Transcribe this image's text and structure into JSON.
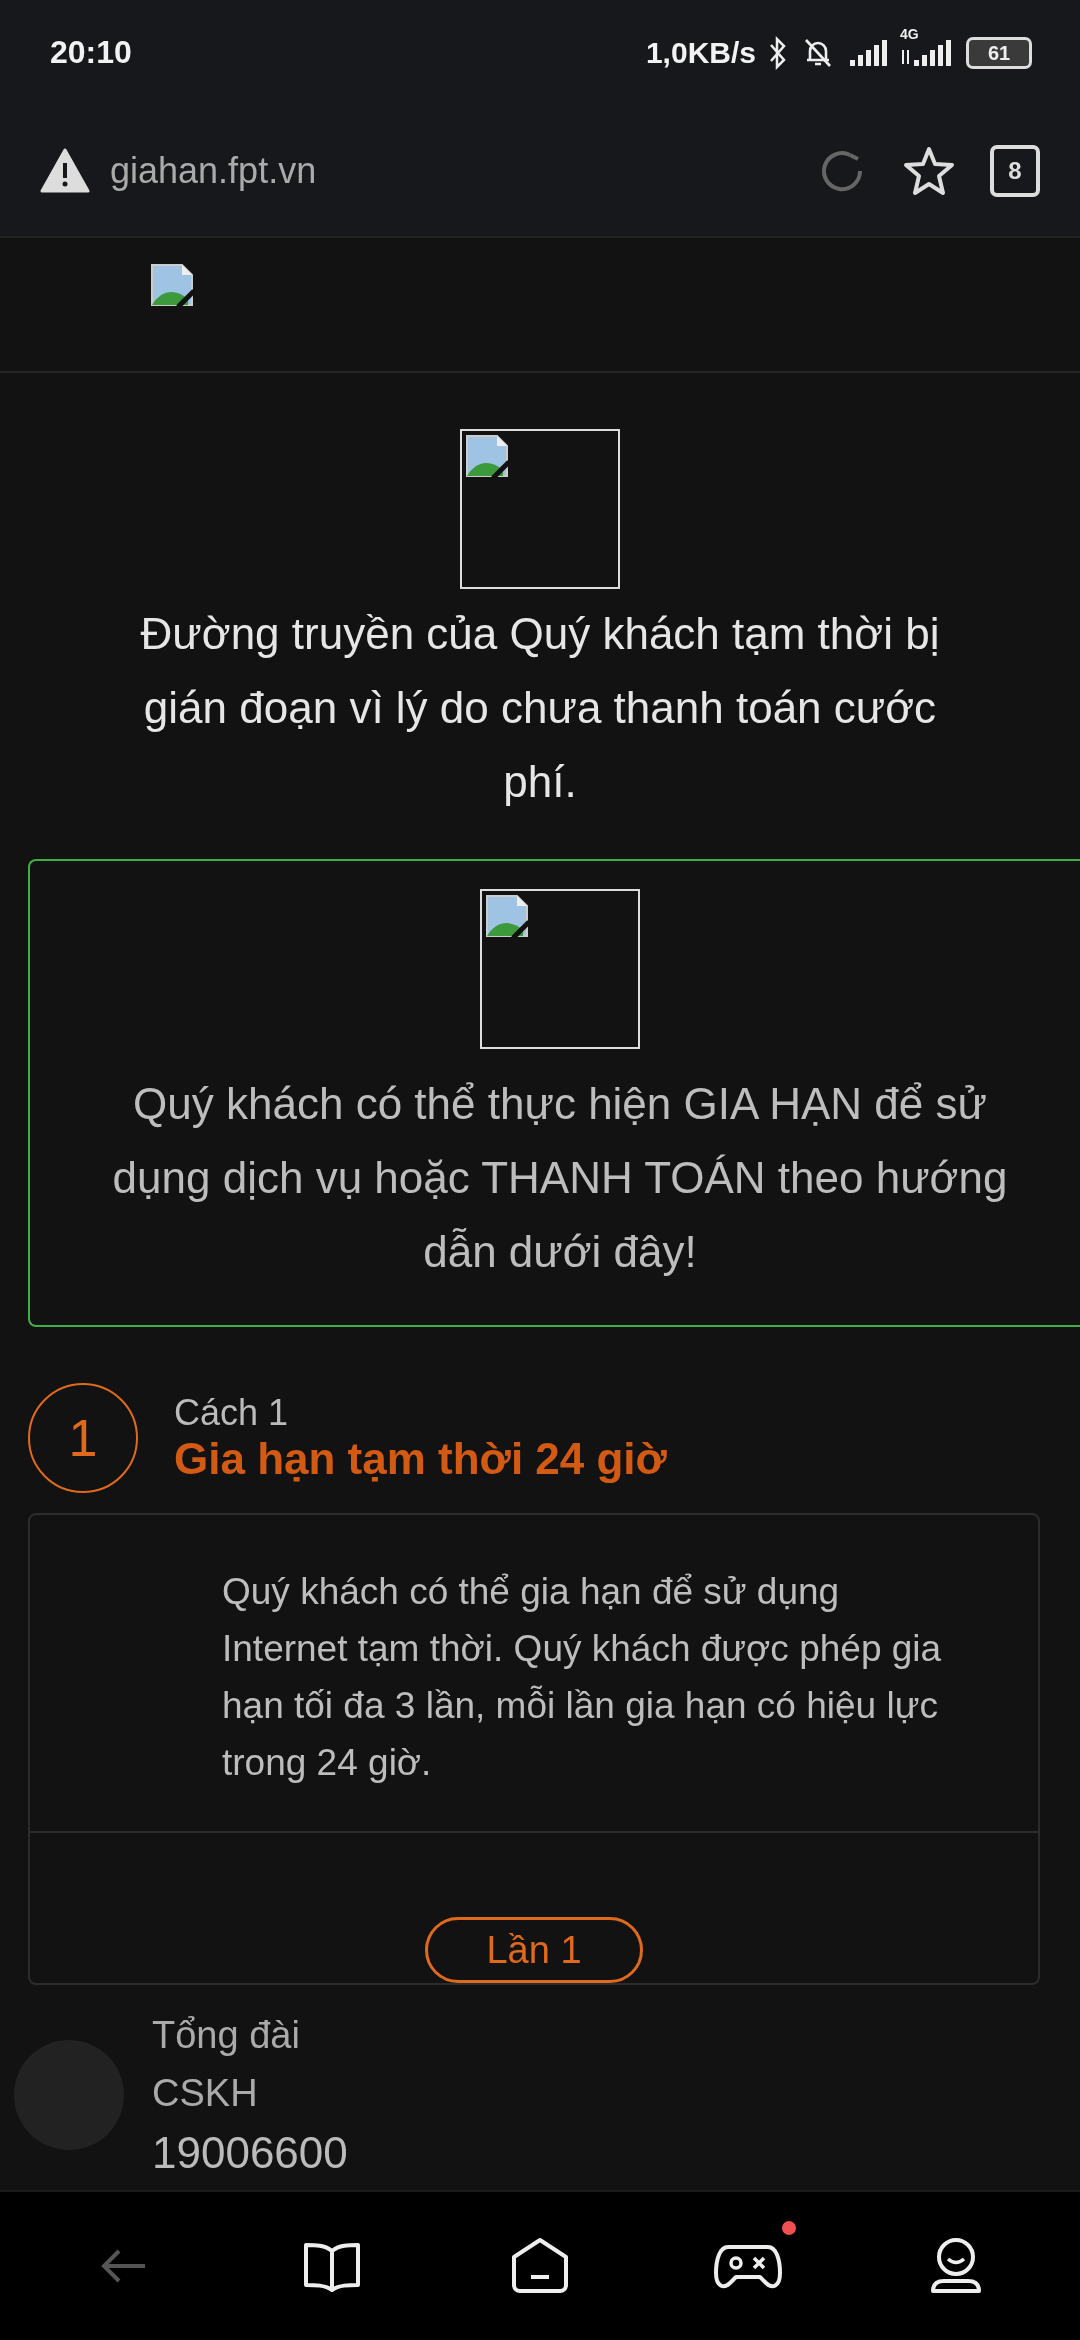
{
  "status_bar": {
    "time": "20:10",
    "network_speed": "1,0KB/s",
    "network_type": "4G",
    "battery": "61"
  },
  "browser": {
    "url": "giahan.fpt.vn",
    "tab_count": "8"
  },
  "notice": {
    "message": "Đường truyền của Quý khách tạm thời bị gián đoạn vì lý do chưa thanh toán cước phí."
  },
  "callout": {
    "message": "Quý khách có thể thực hiện GIA HẠN để sử dụng dịch vụ hoặc THANH TOÁN theo hướng dẫn dưới đây!"
  },
  "steps": [
    {
      "number": "1",
      "label": "Cách 1",
      "title": "Gia hạn tạm thời 24 giờ",
      "description": "Quý khách có thể gia hạn để sử dụng Internet tạm thời. Quý khách được phép gia hạn tối đa 3 lần, mỗi lần gia hạn có hiệu lực trong 24 giờ.",
      "buttons": [
        "Lần 1"
      ]
    }
  ],
  "contact": {
    "label_line_1": "Tổng đài",
    "label_line_2": "CSKH",
    "phone": "19006600"
  },
  "nav": {
    "items": [
      {
        "kind": "back",
        "disabled": true,
        "badge": false
      },
      {
        "kind": "book",
        "disabled": false,
        "badge": false
      },
      {
        "kind": "home",
        "disabled": false,
        "badge": false
      },
      {
        "kind": "game",
        "disabled": false,
        "badge": true
      },
      {
        "kind": "profile",
        "disabled": false,
        "badge": false
      }
    ]
  }
}
